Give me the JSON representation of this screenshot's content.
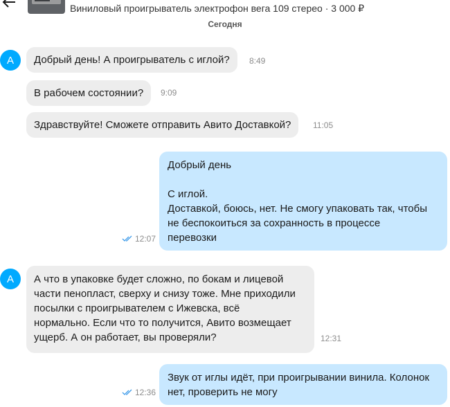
{
  "header": {
    "item_title": "Виниловый проигрыватель электрофон вега 109 стерео · 3 000 ₽"
  },
  "date_separator": "Сегодня",
  "avatar_letter": "A",
  "messages": [
    {
      "text": "Добрый день! А проигрыватель с иглой?",
      "time": "8:49",
      "direction": "incoming"
    },
    {
      "text": "В рабочем состоянии?",
      "time": "9:09",
      "direction": "incoming"
    },
    {
      "text": "Здравствуйте! Сможете отправить Авито Доставкой?",
      "time": "11:05",
      "direction": "incoming"
    },
    {
      "text": "Добрый день\n\nС иглой.\nДоставкой, боюсь, нет. Не смогу упаковать так, чтобы\nне беспокоиться за сохранность в процессе\nперевозки",
      "time": "12:07",
      "direction": "outgoing",
      "read": true
    },
    {
      "text": "А что в упаковке будет сложно, по бокам и лицевой\nчасти пенопласт, сверху и снизу тоже. Мне приходили\nпосылки с проигрывателем с Ижевска, всё\nнормально. Если что то получится, Авито возмещает\nущерб. А он работает, вы проверяли?",
      "time": "12:31",
      "direction": "incoming"
    },
    {
      "text": "Звук от иглы идёт, при проигрывании винила. Колонок\nнет, проверить не могу",
      "time": "12:36",
      "direction": "outgoing",
      "read": true
    }
  ],
  "colors": {
    "incoming_bubble": "#ededed",
    "outgoing_bubble": "#c8e8ff",
    "avatar": "#00aaff",
    "read_ticks": "#3d9be9"
  },
  "icons": {
    "back": "arrow-left-icon",
    "read_status": "double-check-icon"
  }
}
